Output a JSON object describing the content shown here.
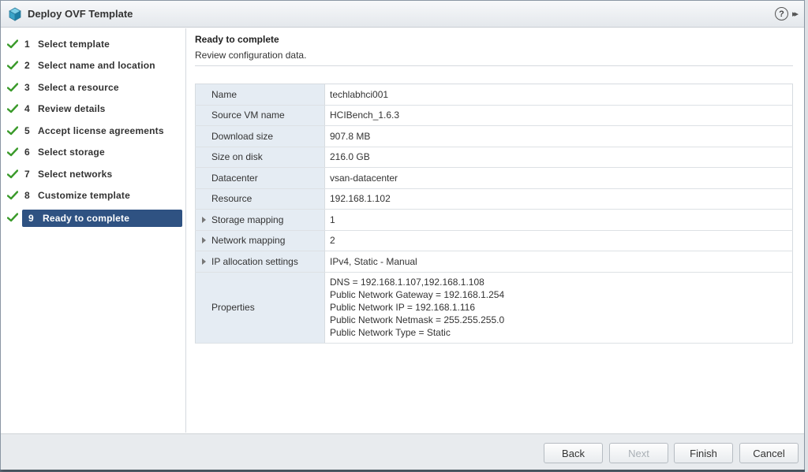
{
  "window": {
    "title": "Deploy OVF Template",
    "help_symbol": "?",
    "expand_symbol": "▸▸"
  },
  "steps": [
    {
      "number": "1",
      "label": "Select template",
      "done": true
    },
    {
      "number": "2",
      "label": "Select name and location",
      "done": true
    },
    {
      "number": "3",
      "label": "Select a resource",
      "done": true
    },
    {
      "number": "4",
      "label": "Review details",
      "done": true
    },
    {
      "number": "5",
      "label": "Accept license agreements",
      "done": true
    },
    {
      "number": "6",
      "label": "Select storage",
      "done": true
    },
    {
      "number": "7",
      "label": "Select networks",
      "done": true
    },
    {
      "number": "8",
      "label": "Customize template",
      "done": true
    },
    {
      "number": "9",
      "label": "Ready to complete",
      "done": true,
      "active": true
    }
  ],
  "main": {
    "title": "Ready to complete",
    "subtitle": "Review configuration data.",
    "rows": [
      {
        "key": "Name",
        "value": "techlabhci001",
        "expandable": false
      },
      {
        "key": "Source VM name",
        "value": "HCIBench_1.6.3",
        "expandable": false
      },
      {
        "key": "Download size",
        "value": "907.8 MB",
        "expandable": false
      },
      {
        "key": "Size on disk",
        "value": "216.0 GB",
        "expandable": false
      },
      {
        "key": "Datacenter",
        "value": "vsan-datacenter",
        "expandable": false
      },
      {
        "key": "Resource",
        "value": "192.168.1.102",
        "expandable": false
      },
      {
        "key": "Storage mapping",
        "value": "1",
        "expandable": true
      },
      {
        "key": "Network mapping",
        "value": "2",
        "expandable": true
      },
      {
        "key": "IP allocation settings",
        "value": "IPv4, Static - Manual",
        "expandable": true
      }
    ],
    "properties": {
      "key": "Properties",
      "lines": [
        "DNS = 192.168.1.107,192.168.1.108",
        "Public Network Gateway = 192.168.1.254",
        "Public Network IP = 192.168.1.116",
        "Public Network Netmask = 255.255.255.0",
        "Public Network Type = Static"
      ]
    }
  },
  "footer": {
    "back_label": "Back",
    "next_label": "Next",
    "finish_label": "Finish",
    "cancel_label": "Cancel"
  },
  "colors": {
    "active_step_bg": "#2f5282",
    "check_green": "#3a9a2a",
    "key_cell_bg": "#e5ecf3"
  }
}
